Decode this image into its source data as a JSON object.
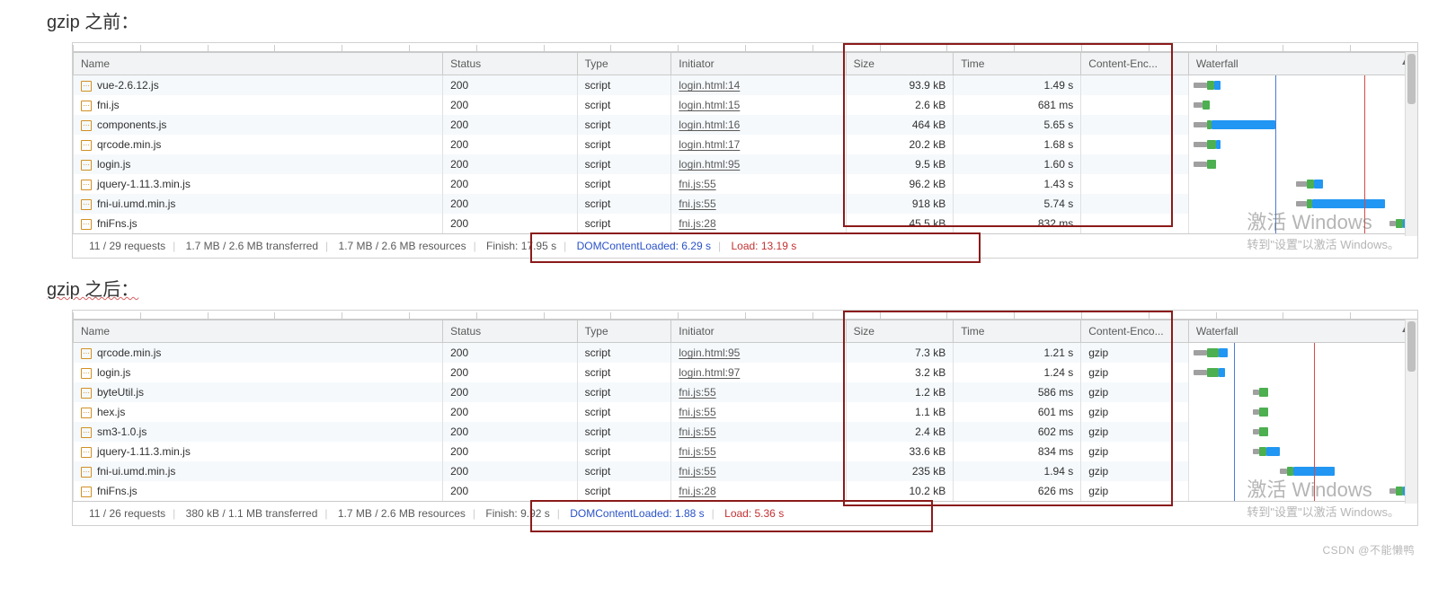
{
  "titles": {
    "before": "gzip 之前：",
    "after": "gzip 之后："
  },
  "columns": {
    "name": "Name",
    "status": "Status",
    "type": "Type",
    "initiator": "Initiator",
    "size": "Size",
    "time": "Time",
    "enc": "Content-Enc...",
    "enc2": "Content-Enco...",
    "waterfall": "Waterfall"
  },
  "before": {
    "rows": [
      {
        "name": "vue-2.6.12.js",
        "status": "200",
        "type": "script",
        "initiator": "login.html:14",
        "size": "93.9 kB",
        "time": "1.49 s",
        "enc": "",
        "bars": [
          [
            "wait",
            2,
            6
          ],
          [
            "ttfb",
            8,
            3
          ],
          [
            "dl",
            11,
            3
          ]
        ]
      },
      {
        "name": "fni.js",
        "status": "200",
        "type": "script",
        "initiator": "login.html:15",
        "size": "2.6 kB",
        "time": "681 ms",
        "enc": "",
        "bars": [
          [
            "wait",
            2,
            4
          ],
          [
            "ttfb",
            6,
            3
          ]
        ]
      },
      {
        "name": "components.js",
        "status": "200",
        "type": "script",
        "initiator": "login.html:16",
        "size": "464 kB",
        "time": "5.65 s",
        "enc": "",
        "bars": [
          [
            "wait",
            2,
            6
          ],
          [
            "ttfb",
            8,
            2
          ],
          [
            "dl",
            10,
            28
          ]
        ]
      },
      {
        "name": "qrcode.min.js",
        "status": "200",
        "type": "script",
        "initiator": "login.html:17",
        "size": "20.2 kB",
        "time": "1.68 s",
        "enc": "",
        "bars": [
          [
            "wait",
            2,
            6
          ],
          [
            "ttfb",
            8,
            4
          ],
          [
            "dl",
            12,
            2
          ]
        ]
      },
      {
        "name": "login.js",
        "status": "200",
        "type": "script",
        "initiator": "login.html:95",
        "size": "9.5 kB",
        "time": "1.60 s",
        "enc": "",
        "bars": [
          [
            "wait",
            2,
            6
          ],
          [
            "ttfb",
            8,
            4
          ]
        ]
      },
      {
        "name": "jquery-1.11.3.min.js",
        "status": "200",
        "type": "script",
        "initiator": "fni.js:55",
        "size": "96.2 kB",
        "time": "1.43 s",
        "enc": "",
        "bars": [
          [
            "wait",
            47,
            5
          ],
          [
            "ttfb",
            52,
            3
          ],
          [
            "dl",
            55,
            4
          ]
        ]
      },
      {
        "name": "fni-ui.umd.min.js",
        "status": "200",
        "type": "script",
        "initiator": "fni.js:55",
        "size": "918 kB",
        "time": "5.74 s",
        "enc": "",
        "bars": [
          [
            "wait",
            47,
            5
          ],
          [
            "ttfb",
            52,
            2
          ],
          [
            "dl",
            54,
            32
          ]
        ]
      },
      {
        "name": "fniFns.js",
        "status": "200",
        "type": "script",
        "initiator": "fni.js:28",
        "size": "45.5 kB",
        "time": "832 ms",
        "enc": "",
        "bars": [
          [
            "wait",
            88,
            3
          ],
          [
            "ttfb",
            91,
            3
          ],
          [
            "dl",
            94,
            2
          ]
        ]
      }
    ],
    "footer": {
      "requests": "11 / 29 requests",
      "transferred": "1.7 MB / 2.6 MB transferred",
      "resources": "1.7 MB / 2.6 MB resources",
      "finish": "Finish: 17.95 s",
      "dcl": "DOMContentLoaded: 6.29 s",
      "load": "Load: 13.19 s"
    },
    "vlines": {
      "blue": 38,
      "red": 77
    }
  },
  "after": {
    "rows": [
      {
        "name": "qrcode.min.js",
        "status": "200",
        "type": "script",
        "initiator": "login.html:95",
        "size": "7.3 kB",
        "time": "1.21 s",
        "enc": "gzip",
        "bars": [
          [
            "wait",
            2,
            6
          ],
          [
            "ttfb",
            8,
            5
          ],
          [
            "dl",
            13,
            4
          ]
        ]
      },
      {
        "name": "login.js",
        "status": "200",
        "type": "script",
        "initiator": "login.html:97",
        "size": "3.2 kB",
        "time": "1.24 s",
        "enc": "gzip",
        "bars": [
          [
            "wait",
            2,
            6
          ],
          [
            "ttfb",
            8,
            5
          ],
          [
            "dl",
            13,
            3
          ]
        ]
      },
      {
        "name": "byteUtil.js",
        "status": "200",
        "type": "script",
        "initiator": "fni.js:55",
        "size": "1.2 kB",
        "time": "586 ms",
        "enc": "gzip",
        "bars": [
          [
            "wait",
            28,
            3
          ],
          [
            "ttfb",
            31,
            4
          ]
        ]
      },
      {
        "name": "hex.js",
        "status": "200",
        "type": "script",
        "initiator": "fni.js:55",
        "size": "1.1 kB",
        "time": "601 ms",
        "enc": "gzip",
        "bars": [
          [
            "wait",
            28,
            3
          ],
          [
            "ttfb",
            31,
            4
          ]
        ]
      },
      {
        "name": "sm3-1.0.js",
        "status": "200",
        "type": "script",
        "initiator": "fni.js:55",
        "size": "2.4 kB",
        "time": "602 ms",
        "enc": "gzip",
        "bars": [
          [
            "wait",
            28,
            3
          ],
          [
            "ttfb",
            31,
            4
          ]
        ]
      },
      {
        "name": "jquery-1.11.3.min.js",
        "status": "200",
        "type": "script",
        "initiator": "fni.js:55",
        "size": "33.6 kB",
        "time": "834 ms",
        "enc": "gzip",
        "bars": [
          [
            "wait",
            28,
            3
          ],
          [
            "ttfb",
            31,
            3
          ],
          [
            "dl",
            34,
            6
          ]
        ]
      },
      {
        "name": "fni-ui.umd.min.js",
        "status": "200",
        "type": "script",
        "initiator": "fni.js:55",
        "size": "235 kB",
        "time": "1.94 s",
        "enc": "gzip",
        "bars": [
          [
            "wait",
            40,
            3
          ],
          [
            "ttfb",
            43,
            3
          ],
          [
            "dl",
            46,
            18
          ]
        ]
      },
      {
        "name": "fniFns.js",
        "status": "200",
        "type": "script",
        "initiator": "fni.js:28",
        "size": "10.2 kB",
        "time": "626 ms",
        "enc": "gzip",
        "bars": [
          [
            "wait",
            88,
            3
          ],
          [
            "ttfb",
            91,
            3
          ],
          [
            "dl",
            94,
            3
          ]
        ]
      }
    ],
    "footer": {
      "requests": "11 / 26 requests",
      "transferred": "380 kB / 1.1 MB transferred",
      "resources": "1.7 MB / 2.6 MB resources",
      "finish": "Finish: 9.92 s",
      "dcl": "DOMContentLoaded: 1.88 s",
      "load": "Load: 5.36 s"
    },
    "vlines": {
      "blue": 20,
      "red": 55
    }
  },
  "watermark": {
    "big": "激活 Windows",
    "sm": "转到\"设置\"以激活 Windows。"
  },
  "csdn": "CSDN @不能懒鸭"
}
